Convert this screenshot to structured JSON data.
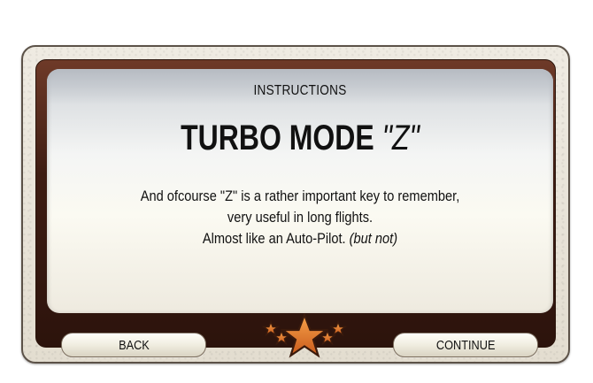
{
  "dialog": {
    "label": "INSTRUCTIONS",
    "title_main": "TURBO MODE",
    "title_key": "\"Z\"",
    "body": {
      "line1": "And ofcourse \"Z\" is a rather important key to remember,",
      "line2": "very useful in long flights.",
      "line3_main": "Almost like an Auto-Pilot.",
      "line3_aside": "(but not)"
    }
  },
  "buttons": {
    "back_label": "BACK",
    "continue_label": "CONTINUE"
  },
  "colors": {
    "frame_brown": "#3e1d13",
    "star_orange": "#e0782a",
    "star_outline": "#3a1a0c"
  }
}
